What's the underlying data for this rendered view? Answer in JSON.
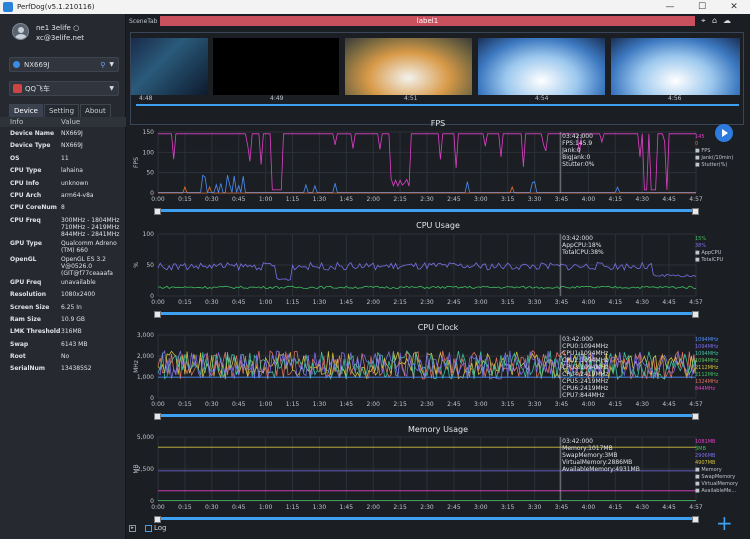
{
  "window": {
    "title": "PerfDog(v5.1.210116)",
    "minimize": "—",
    "maximize": "☐",
    "close": "✕"
  },
  "user": {
    "name": "ne​1 3elife ○",
    "email": "xc@3elife.net"
  },
  "device_selector": {
    "label": "NX669J",
    "icon": "phone-icon"
  },
  "app_selector": {
    "label": "QQ飞车",
    "icon": "game-icon"
  },
  "tabs": [
    "Device",
    "Setting",
    "About"
  ],
  "info_table": {
    "headers": [
      "Info",
      "Value"
    ],
    "rows": [
      [
        "Device Name",
        "NX669J"
      ],
      [
        "Device Type",
        "NX669J"
      ],
      [
        "OS",
        "11"
      ],
      [
        "CPU Type",
        "lahaina"
      ],
      [
        "CPU Info",
        "unknown"
      ],
      [
        "CPU Arch",
        "arm64-v8a"
      ],
      [
        "CPU CoreNum",
        "8"
      ],
      [
        "CPU Freq",
        "300MHz - 1804MHz\n710MHz - 2419MHz\n844MHz - 2841MHz"
      ],
      [
        "GPU Type",
        "Qualcomm Adreno\n(TM) 660"
      ],
      [
        "OpenGL",
        "OpenGL ES 3.2\nV@0526.0\n(GIT@f77ceaaafa"
      ],
      [
        "GPU Freq",
        "unavailable"
      ],
      [
        "Resolution",
        "1080x2400"
      ],
      [
        "Screen Size",
        "6.25 In"
      ],
      [
        "Ram Size",
        "10.9 GB"
      ],
      [
        "LMK Threshold",
        "316MB"
      ],
      [
        "Swap",
        "6143 MB"
      ],
      [
        "Root",
        "No"
      ],
      [
        "SerialNum",
        "134385S2"
      ]
    ]
  },
  "scene": {
    "label": "SceneTab",
    "value": "label1"
  },
  "thumbnails": {
    "times": [
      "4:48",
      "4:49",
      "4:51",
      "4:54",
      "4:56"
    ]
  },
  "x_ticks": [
    "0:00",
    "0:15",
    "0:30",
    "0:45",
    "1:00",
    "1:15",
    "1:30",
    "1:45",
    "2:00",
    "2:15",
    "2:30",
    "2:45",
    "3:00",
    "3:15",
    "3:30",
    "3:45",
    "4:00",
    "4:15",
    "4:30",
    "4:45",
    "4:57"
  ],
  "charts": {
    "fps": {
      "title": "FPS",
      "ylabel": "FPS",
      "yticks": [
        "150",
        "100",
        "50",
        "0"
      ],
      "readout": [
        "03:42:000",
        "FPS:145.9",
        "Jank:0",
        "BigJank:0",
        "Stutter:0%"
      ],
      "legend": [
        {
          "v": "145",
          "c": "#e040c8"
        },
        {
          "v": "0",
          "c": "#e07030"
        }
      ],
      "series": [
        "FPS",
        "Jank(/10min)",
        "Stutter(%)"
      ],
      "colors": {
        "fps": "#e040c8",
        "jank": "#e07030",
        "stutter": "#4e8ef7"
      }
    },
    "cpu": {
      "title": "CPU Usage",
      "ylabel": "%",
      "yticks": [
        "100",
        "50",
        "0"
      ],
      "readout": [
        "03:42:000",
        "AppCPU:18%",
        "TotalCPU:38%"
      ],
      "legend": [
        {
          "v": "15%",
          "c": "#3fbf5f"
        },
        {
          "v": "38%",
          "c": "#7a6ee6"
        }
      ],
      "series": [
        "AppCPU",
        "TotalCPU"
      ],
      "colors": {
        "app": "#3fbf5f",
        "total": "#7a6ee6"
      }
    },
    "clock": {
      "title": "CPU Clock",
      "ylabel": "MHz",
      "yticks": [
        "3,000",
        "2,000",
        "1,000",
        "0"
      ],
      "readout": [
        "03:42:000",
        "CPU0:1094MHz",
        "CPU1:1094MHz",
        "CPU2:1094MHz",
        "CPU3:1094MHz",
        "CPU4:2419MHz",
        "CPU5:2419MHz",
        "CPU6:2419MHz",
        "CPU7:844MHz"
      ],
      "legend": [
        {
          "v": "1094MHz",
          "c": "#4e8ef7"
        },
        {
          "v": "1094MHz",
          "c": "#7a6ee6"
        },
        {
          "v": "1094MHz",
          "c": "#3fbf9f"
        },
        {
          "v": "1094MHz",
          "c": "#5fbf5f"
        },
        {
          "v": "2112MHz",
          "c": "#d0c040"
        },
        {
          "v": "2112MHz",
          "c": "#3fbf5f"
        },
        {
          "v": "1324MHz",
          "c": "#e07060"
        },
        {
          "v": "844MHz",
          "c": "#e040c8"
        }
      ]
    },
    "memory": {
      "title": "Memory Usage",
      "ylabel": "MB",
      "yticks": [
        "5,000",
        "2,500",
        "0"
      ],
      "readout": [
        "03:42:000",
        "Memory:1017MB",
        "SwapMemory:3MB",
        "VirtualMemory:2886MB",
        "AvailableMemory:4931MB"
      ],
      "legend": [
        {
          "v": "1081MB",
          "c": "#e040c8"
        },
        {
          "v": "3MB",
          "c": "#3fbf5f"
        },
        {
          "v": "2906MB",
          "c": "#7a6ee6"
        },
        {
          "v": "4907MB",
          "c": "#d0c040"
        }
      ],
      "series": [
        "Memory",
        "SwapMemory",
        "VirtualMemory",
        "AvailableMe..."
      ]
    }
  },
  "log": {
    "label": "Log"
  },
  "chart_data": [
    {
      "type": "line",
      "title": "FPS",
      "ylabel": "FPS",
      "ylim": [
        0,
        150
      ],
      "x": [
        "0:00",
        "0:15",
        "0:30",
        "0:45",
        "1:00",
        "1:15",
        "1:30",
        "1:45",
        "2:00",
        "2:15",
        "2:30",
        "2:45",
        "3:00",
        "3:15",
        "3:30",
        "3:45",
        "4:00",
        "4:15",
        "4:30",
        "4:45",
        "4:57"
      ],
      "series": [
        {
          "name": "FPS",
          "values": [
            145,
            146,
            145,
            146,
            145,
            100,
            146,
            146,
            145,
            146,
            146,
            145,
            146,
            146,
            145,
            146,
            145,
            146,
            145,
            146,
            145
          ]
        }
      ]
    },
    {
      "type": "line",
      "title": "CPU Usage",
      "ylabel": "%",
      "ylim": [
        0,
        100
      ],
      "x": [
        "0:00",
        "0:15",
        "0:30",
        "0:45",
        "1:00",
        "1:15",
        "1:30",
        "1:45",
        "2:00",
        "2:15",
        "2:30",
        "2:45",
        "3:00",
        "3:15",
        "3:30",
        "3:45",
        "4:00",
        "4:15",
        "4:30",
        "4:45",
        "4:57"
      ],
      "series": [
        {
          "name": "AppCPU",
          "values": [
            12,
            14,
            13,
            14,
            13,
            12,
            14,
            14,
            13,
            13,
            15,
            14,
            14,
            15,
            14,
            16,
            15,
            14,
            15,
            14,
            15
          ]
        },
        {
          "name": "TotalCPU",
          "values": [
            45,
            42,
            43,
            40,
            38,
            30,
            36,
            38,
            37,
            36,
            38,
            36,
            40,
            38,
            38,
            37,
            36,
            37,
            35,
            37,
            38
          ]
        }
      ]
    },
    {
      "type": "line",
      "title": "Memory Usage",
      "ylabel": "MB",
      "ylim": [
        0,
        6000
      ],
      "x": [
        "0:00",
        "4:57"
      ],
      "series": [
        {
          "name": "Memory",
          "values": [
            1000,
            1081
          ]
        },
        {
          "name": "SwapMemory",
          "values": [
            3,
            3
          ]
        },
        {
          "name": "VirtualMemory",
          "values": [
            2880,
            2906
          ]
        },
        {
          "name": "AvailableMe...",
          "values": [
            5000,
            4907
          ]
        }
      ]
    }
  ]
}
